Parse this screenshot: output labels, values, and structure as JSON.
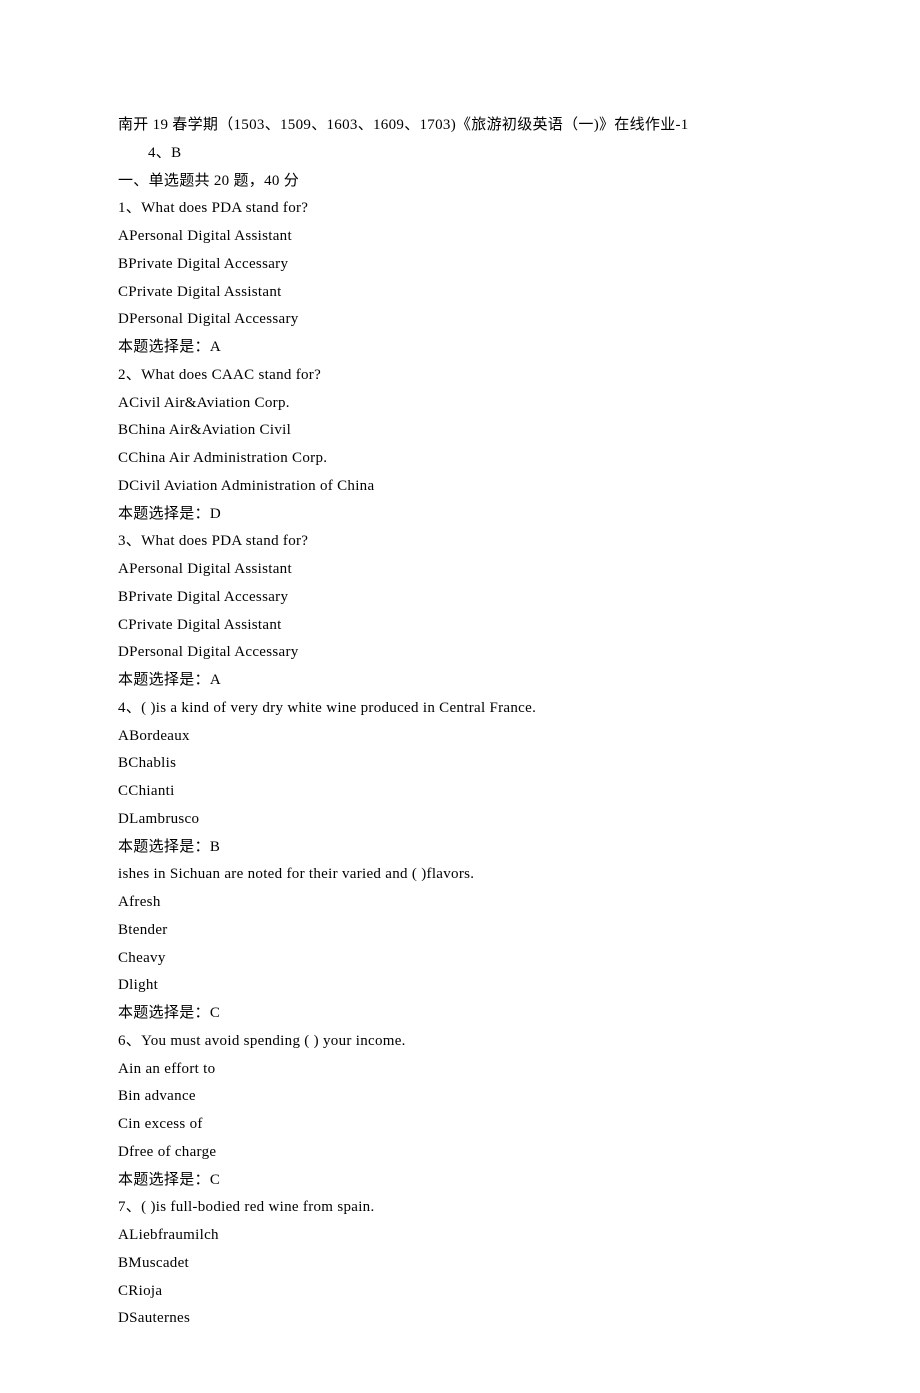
{
  "header_line": "南开 19 春学期（1503、1509、1603、1609、1703)《旅游初级英语（一)》在线作业-1",
  "header_sub": "4、B",
  "section1_heading": "一、单选题共 20 题，40 分",
  "answer_prefix": "本题选择是：",
  "questions": [
    {
      "prompt": "1、What does PDA stand for?",
      "options": [
        "APersonal Digital Assistant",
        "BPrivate Digital Accessary",
        "CPrivate Digital Assistant",
        "DPersonal Digital Accessary"
      ],
      "answer": "A"
    },
    {
      "prompt": "2、What does CAAC stand for?",
      "options": [
        "ACivil Air&Aviation Corp.",
        "BChina Air&Aviation Civil",
        "CChina Air Administration Corp.",
        "DCivil Aviation Administration of China"
      ],
      "answer": "D"
    },
    {
      "prompt": "3、What does PDA stand for?",
      "options": [
        "APersonal Digital Assistant",
        "BPrivate Digital Accessary",
        "CPrivate Digital Assistant",
        "DPersonal Digital Accessary"
      ],
      "answer": "A"
    },
    {
      "prompt": "4、( )is a kind of very dry white wine produced in Central France.",
      "options": [
        "ABordeaux",
        "BChablis",
        "CChianti",
        "DLambrusco"
      ],
      "answer": "B"
    },
    {
      "prompt": "ishes in Sichuan are noted for their varied and ( )flavors.",
      "options": [
        "Afresh",
        "Btender",
        "Cheavy",
        "Dlight"
      ],
      "answer": "C"
    },
    {
      "prompt": "6、You must avoid spending ( ) your income.",
      "options": [
        "Ain an effort to",
        "Bin advance",
        "Cin excess of",
        "Dfree of charge"
      ],
      "answer": "C"
    },
    {
      "prompt": "7、( )is full-bodied red wine from spain.",
      "options": [
        "ALiebfraumilch",
        "BMuscadet",
        "CRioja",
        "DSauternes"
      ],
      "answer": null
    }
  ]
}
